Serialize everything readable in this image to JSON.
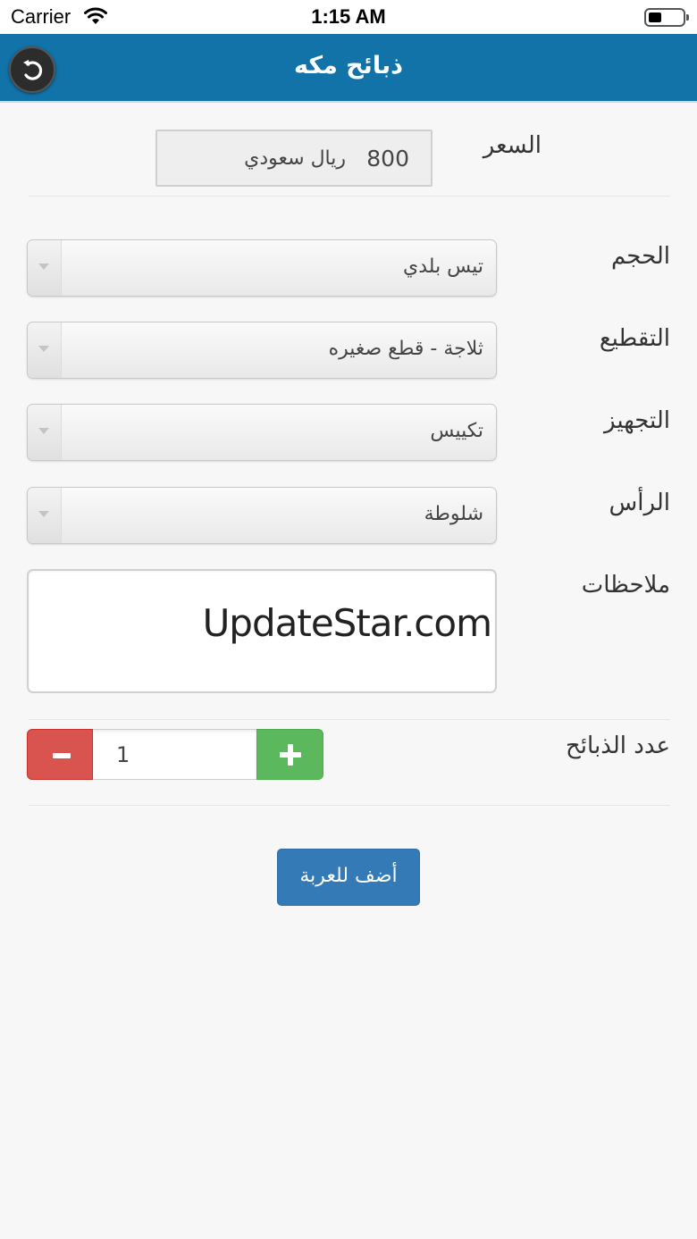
{
  "status_bar": {
    "carrier": "Carrier",
    "time": "1:15 AM"
  },
  "header": {
    "title": "ذبائح مكه",
    "back_icon": "back-arrow-icon"
  },
  "form": {
    "price": {
      "label": "السعر",
      "value": "800",
      "unit": "ريال سعودي"
    },
    "size": {
      "label": "الحجم",
      "selected": "تيس بلدي"
    },
    "cutting": {
      "label": "التقطيع",
      "selected": "ثلاجة - قطع صغيره"
    },
    "packing": {
      "label": "التجهيز",
      "selected": "تكييس"
    },
    "head": {
      "label": "الرأس",
      "selected": "شلوطة"
    },
    "notes": {
      "label": "ملاحظات",
      "value": "UpdateStar.com"
    },
    "quantity": {
      "label": "عدد الذبائح",
      "value": "1"
    }
  },
  "actions": {
    "add_to_cart_label": "أضف للعربة"
  },
  "colors": {
    "header_bg": "#1173a8",
    "minus_button": "#d9534f",
    "plus_button": "#5cb85c",
    "primary_button": "#337ab7"
  }
}
